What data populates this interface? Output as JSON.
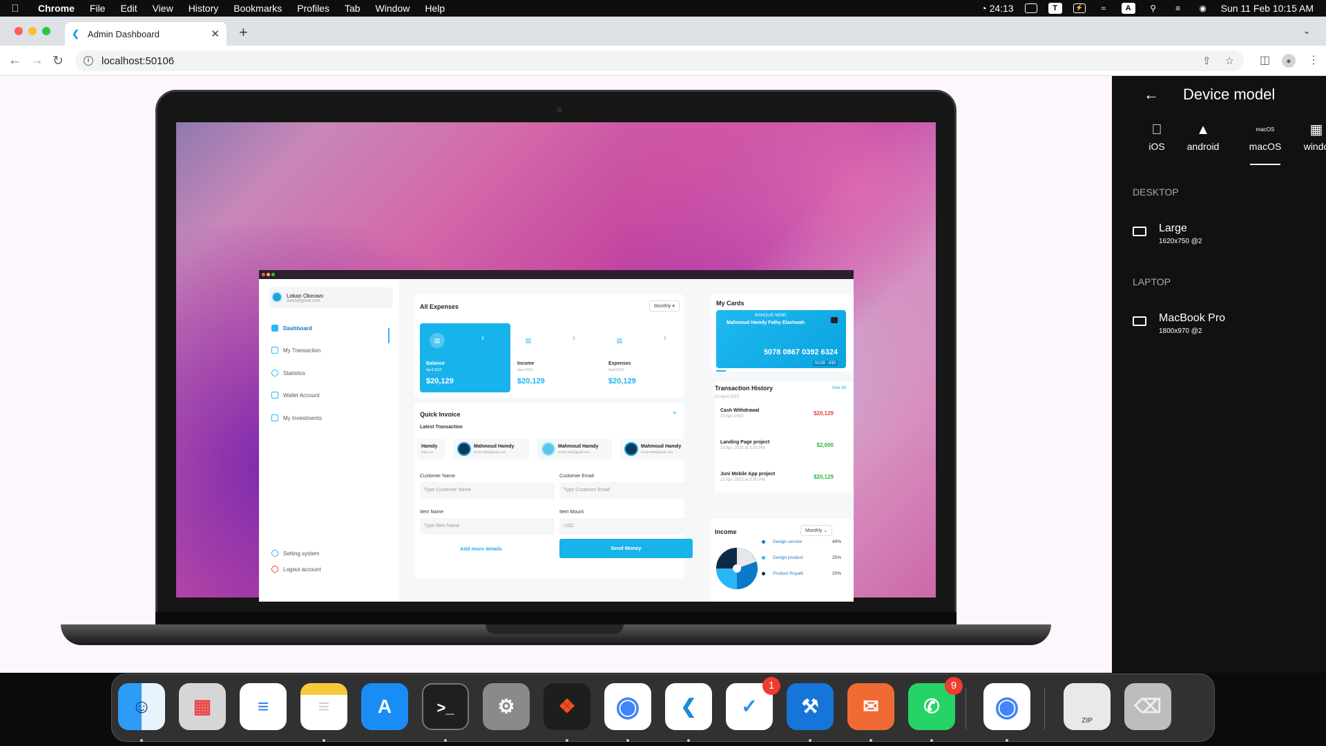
{
  "menubar": {
    "app": "Chrome",
    "items": [
      "File",
      "Edit",
      "View",
      "History",
      "Bookmarks",
      "Profiles",
      "Tab",
      "Window",
      "Help"
    ],
    "timer": "24:13",
    "input_source": "A",
    "datetime": "Sun 11 Feb  10:15 AM"
  },
  "browser": {
    "tab_title": "Admin Dashboard",
    "url": "localhost:50106"
  },
  "dashboard": {
    "user": {
      "name": "Lekan Okeowo",
      "email": "demo@gmail.com"
    },
    "nav": [
      "Dashboard",
      "My Transaction",
      "Statistics",
      "Wallet Account",
      "My Investments"
    ],
    "nav_bottom": [
      "Setting system",
      "Logout account"
    ],
    "expenses": {
      "title": "All Expenses",
      "filter": "Monthly",
      "cards": [
        {
          "label": "Balance",
          "date": "April 2022",
          "value": "$20,129"
        },
        {
          "label": "Income",
          "date": "April 2022",
          "value": "$20,129"
        },
        {
          "label": "Expenses",
          "date": "April 2022",
          "value": "$20,129"
        }
      ]
    },
    "invoice": {
      "title": "Quick Invoice",
      "plus": "+",
      "latest": "Latest Transaction",
      "contacts": [
        {
          "name": "Hamdy",
          "email": "mail.com"
        },
        {
          "name": "Mahmoud Hamdy",
          "email": "hmdy7456@gmail.com"
        },
        {
          "name": "Mahmoud Hamdy",
          "email": "hmdy7456@gmail.com"
        },
        {
          "name": "Mahmoud Hamdy",
          "email": "hmdy7456@gmail.com"
        }
      ],
      "customer_name_label": "Customer Name",
      "customer_name_ph": "Type Customer Name",
      "customer_email_label": "Customer Email",
      "customer_email_ph": "Type Customer Email",
      "item_name_label": "Item Name",
      "item_name_ph": "Type Item Name",
      "item_mount_label": "Item Mount",
      "item_mount_ph": "USD",
      "add_more": "Add more details",
      "send": "Send Money"
    },
    "cards": {
      "title": "My Cards",
      "bank": "BANQUE MISR",
      "holder": "Mahmoud Hamdy Fathy Elashwah",
      "number": "5078 0867 0392 6324",
      "expiry": "01/28 - 830"
    },
    "history": {
      "title": "Transaction History",
      "see_all": "See All",
      "date": "13 April 2022",
      "items": [
        {
          "title": "Cash Withdrawal",
          "date": "13 Apr, 2022",
          "amount": "$20,129",
          "color": "#e8413b"
        },
        {
          "title": "Landing Page project",
          "date": "13 Apr, 2022 at 3:30 PM",
          "amount": "$2,000",
          "color": "#2fb344"
        },
        {
          "title": "Juni Mobile App project",
          "date": "13 Apr, 2022 at 3:30 PM",
          "amount": "$20,129",
          "color": "#2fb344"
        }
      ]
    },
    "income": {
      "title": "Income",
      "filter": "Monthly",
      "legend": [
        {
          "label": "Design service",
          "pct": "40%",
          "color": "#0b79c7"
        },
        {
          "label": "Design product",
          "pct": "25%",
          "color": "#29b6f6"
        },
        {
          "label": "Product Royalti",
          "pct": "20%",
          "color": "#0d2a45"
        }
      ]
    }
  },
  "device_panel": {
    "title": "Device model",
    "os": [
      "iOS",
      "android",
      "macOS",
      "windo"
    ],
    "selected_os": "macOS",
    "os_small_label": "macOS",
    "sections": [
      {
        "name": "DESKTOP",
        "device": "Large",
        "spec": "1620x750 @2"
      },
      {
        "name": "LAPTOP",
        "device": "MacBook Pro",
        "spec": "1800x970 @2"
      }
    ]
  },
  "dock": {
    "apps": [
      "Finder",
      "Launchpad",
      "Reminders",
      "Notes",
      "App Store",
      "Terminal",
      "System Settings",
      "Figma",
      "Chrome",
      "VS Code",
      "Tasks",
      "Xcode",
      "Postman",
      "WhatsApp",
      "Chrome",
      "Archive",
      "Trash"
    ],
    "badges": {
      "tasks": "1",
      "whatsapp": "9"
    },
    "archive_label": "ZIP"
  }
}
